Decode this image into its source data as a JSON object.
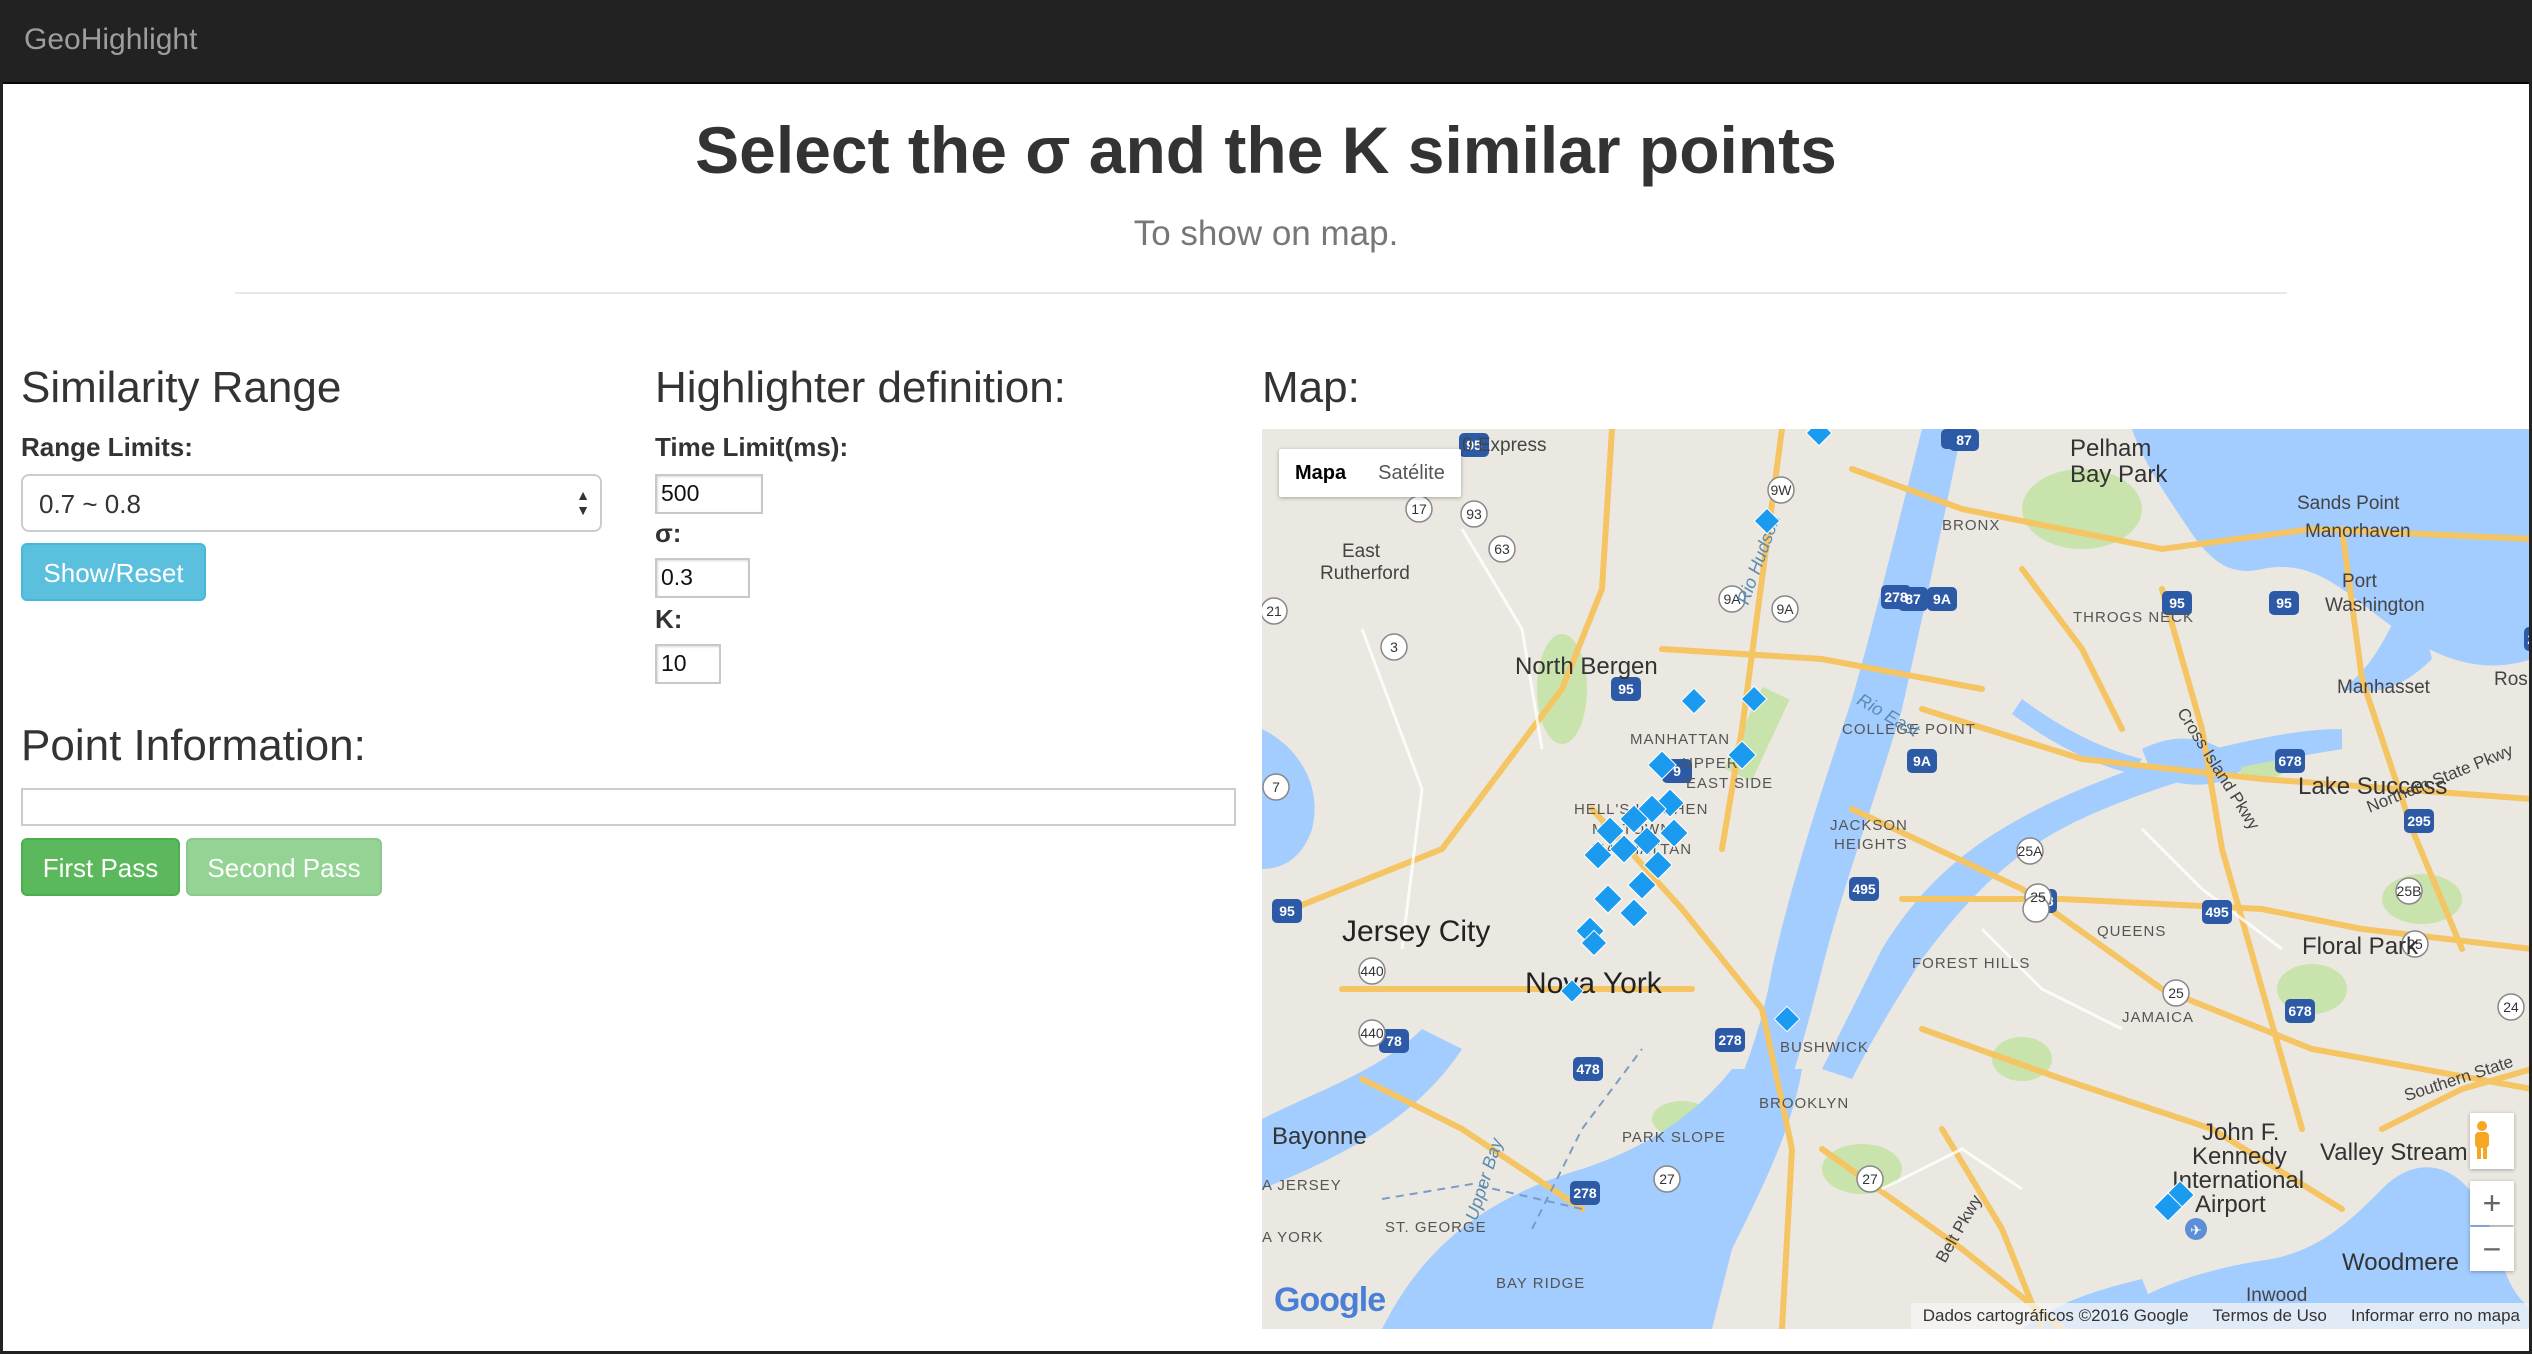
{
  "navbar": {
    "brand": "GeoHighlight"
  },
  "header": {
    "title": "Select the σ and the K similar points",
    "subtitle": "To show on map."
  },
  "similarity": {
    "heading": "Similarity Range",
    "range_label": "Range Limits:",
    "selected_range": "0.7 ~ 0.8",
    "show_reset_label": "Show/Reset"
  },
  "highlighter": {
    "heading": "Highlighter definition:",
    "time_limit_label": "Time Limit(ms):",
    "time_limit_value": "500",
    "sigma_label": "σ:",
    "sigma_value": "0.3",
    "k_label": "K:",
    "k_value": "10"
  },
  "point_info": {
    "heading": "Point Information:",
    "value": "",
    "first_pass_label": "First Pass",
    "second_pass_label": "Second Pass"
  },
  "map": {
    "heading": "Map:",
    "type_map": "Mapa",
    "type_satellite": "Satélite",
    "zoom_in": "+",
    "zoom_out": "−",
    "logo": "Google",
    "footer_data": "Dados cartográficos ©2016 Google",
    "footer_terms": "Termos de Uso",
    "footer_report": "Informar erro no mapa",
    "marker_color": "#1a9bf0",
    "water_color": "#a3ccff",
    "labels": {
      "pelham": "Pelham",
      "bay_park": "Bay Park",
      "sands_point": "Sands Point",
      "manorhaven": "Manorhaven",
      "port_washington": "Port",
      "port_washington_2": "Washington",
      "east_rutherford": "East",
      "east_rutherford_2": "Rutherford",
      "north_bergen": "North Bergen",
      "bronx": "BRONX",
      "throgs_neck": "THROGS NECK",
      "manhasset": "Manhasset",
      "manhattan": "MANHATTAN",
      "upper_east_side": "UPPER",
      "upper_east_side_2": "EAST SIDE",
      "college_point": "COLLEGE POINT",
      "hells_kitchen": "HELL'S KITCHEN",
      "midtown": "MIDTOWN",
      "midtown_2": "MANHATTAN",
      "lake_success": "Lake Success",
      "jackson_heights": "JACKSON",
      "jackson_heights_2": "HEIGHTS",
      "jersey_city": "Jersey City",
      "queens": "QUEENS",
      "floral_park": "Floral Park",
      "forest_hills": "FOREST HILLS",
      "nova_york": "Nova York",
      "jamaica": "JAMAICA",
      "bushwick": "BUSHWICK",
      "brooklyn": "BROOKLYN",
      "bayonne": "Bayonne",
      "park_slope": "PARK SLOPE",
      "jfk": "John F.",
      "jfk_2": "Kennedy",
      "jfk_3": "International",
      "jfk_4": "Airport",
      "valley_stream": "Valley Stream",
      "jersey_edge": "A JERSEY",
      "york_edge": "A YORK",
      "st_george": "ST. GEORGE",
      "bay_ridge": "BAY RIDGE",
      "woodmere": "Woodmere",
      "inwood": "Inwood",
      "rio_hudson": "Rio Hudson",
      "rio_east": "Rio East",
      "upper_bay": "Upper Bay",
      "cross_island": "Cross Island Pkwy",
      "northern_state": "Northern State Pkwy",
      "southern_state": "Southern State",
      "belt_pkwy": "Belt Pkwy",
      "express": "0 Express",
      "ros": "Ros"
    }
  }
}
